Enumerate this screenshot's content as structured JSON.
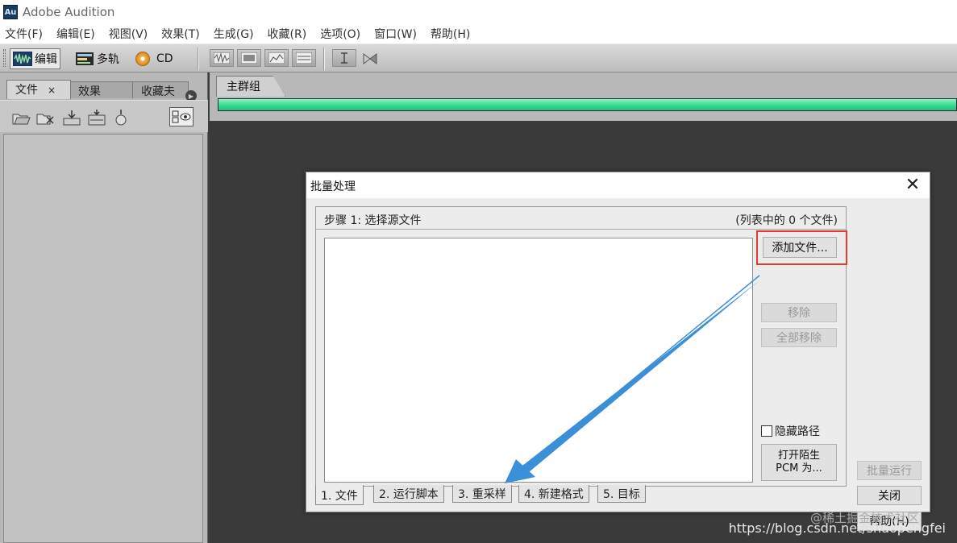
{
  "app": {
    "icon_text": "Au",
    "title": "Adobe Audition"
  },
  "menu": [
    "文件(F)",
    "编辑(E)",
    "视图(V)",
    "效果(T)",
    "生成(G)",
    "收藏(R)",
    "选项(O)",
    "窗口(W)",
    "帮助(H)"
  ],
  "toolbar": {
    "edit_label": "编辑",
    "multitrack_label": "多轨",
    "cd_label": "CD"
  },
  "left_panel": {
    "tabs": [
      "文件",
      "效果",
      "收藏夫"
    ],
    "tab_close": "×"
  },
  "main": {
    "tab_label": "主群组",
    "progress": 1.0
  },
  "dialog": {
    "title": "批量处理",
    "step_title": "步骤 1: 选择源文件",
    "step_count": "(列表中的 0 个文件)",
    "add_files": "添加文件...",
    "remove": "移除",
    "remove_all": "全部移除",
    "hide_path": "隐藏路径",
    "open_line1": "打开陌生",
    "open_line2": "PCM 为...",
    "tabs": [
      "1. 文件",
      "2. 运行脚本",
      "3. 重采样",
      "4. 新建格式",
      "5. 目标"
    ],
    "batch_run": "批量运行",
    "close": "关闭",
    "help": "帮助(H)"
  },
  "watermark": {
    "top": "@稀土掘金技术社区",
    "url": "https://blog.csdn.net/shaopengfei"
  },
  "colors": {
    "highlight": "#e23a32",
    "arrow": "#3a8fd8",
    "progress": "#32d68c"
  }
}
